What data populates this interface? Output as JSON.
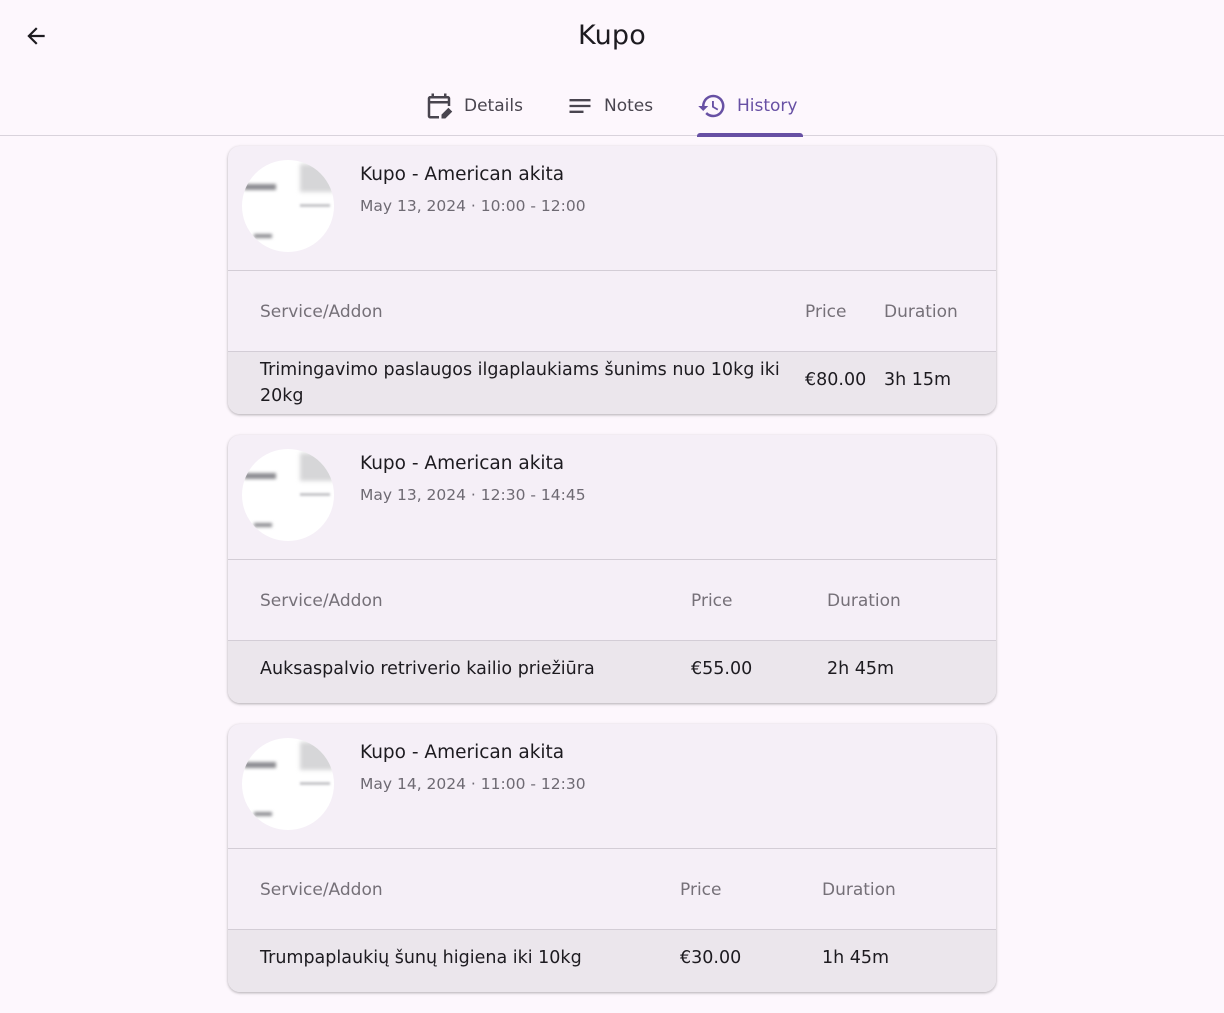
{
  "appbar": {
    "title": "Kupo",
    "back_icon": "arrow-back-icon"
  },
  "tabs": [
    {
      "label": "Details",
      "icon": "calendar-edit-icon",
      "active": false
    },
    {
      "label": "Notes",
      "icon": "notes-lines-icon",
      "active": false
    },
    {
      "label": "History",
      "icon": "history-icon",
      "active": true
    }
  ],
  "colors": {
    "accent": "#6750a4",
    "background": "#fdf7fd",
    "card": "#f5eff7",
    "row": "#ebe6ec"
  },
  "appointments": [
    {
      "title": "Kupo - American akita",
      "datetime": "May 13, 2024 · 10:00 - 12:00",
      "columns": {
        "service": "Service/Addon",
        "price": "Price",
        "duration": "Duration"
      },
      "rows": [
        {
          "service": "Trimingavimo paslaugos ilgaplaukiams šunims nuo 10kg iki 20kg",
          "price": "€80.00",
          "duration": "3h 15m"
        }
      ]
    },
    {
      "title": "Kupo - American akita",
      "datetime": "May 13, 2024 · 12:30 - 14:45",
      "columns": {
        "service": "Service/Addon",
        "price": "Price",
        "duration": "Duration"
      },
      "rows": [
        {
          "service": "Auksaspalvio retriverio kailio priežiūra",
          "price": "€55.00",
          "duration": "2h 45m"
        }
      ]
    },
    {
      "title": "Kupo - American akita",
      "datetime": "May 14, 2024 · 11:00 - 12:30",
      "columns": {
        "service": "Service/Addon",
        "price": "Price",
        "duration": "Duration"
      },
      "rows": [
        {
          "service": "Trumpaplaukių šunų higiena iki 10kg",
          "price": "€30.00",
          "duration": "1h 45m"
        }
      ]
    }
  ]
}
